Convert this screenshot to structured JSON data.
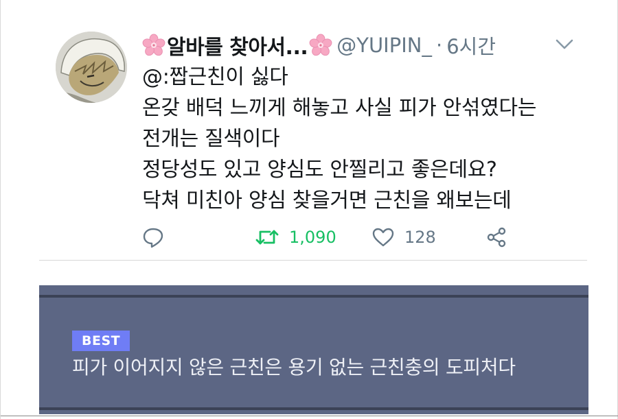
{
  "tweet": {
    "display_name": "알바를 찾아서...",
    "handle": "@YUIPIN_",
    "separator": "·",
    "time": "6시간",
    "lines": [
      "@:짭근친이 싫다",
      "온갖 배덕 느끼게 해놓고 사실 피가 안섞였다는",
      "전개는 질색이다",
      "정당성도 있고 양심도 안찔리고 좋은데요?",
      "닥쳐 미친아 양심 찾을거면 근친을 왜보는데"
    ],
    "retweet_count": "1,090",
    "like_count": "128"
  },
  "comment": {
    "badge": "BEST",
    "text": "피가 이어지지 않은 근친은 용기 없는 근친충의 도피처다"
  },
  "icons": {
    "name_decoration": "cherry-blossom-icon",
    "menu": "chevron-down-icon",
    "reply": "reply-icon",
    "retweet": "retweet-icon",
    "like": "heart-icon",
    "share": "share-icon"
  },
  "colors": {
    "retweet_active": "#17bf63",
    "muted": "#657786",
    "blossom": "#f7a8c3",
    "card_bg": "#5c6684",
    "badge_bg": "#6f7df5"
  }
}
